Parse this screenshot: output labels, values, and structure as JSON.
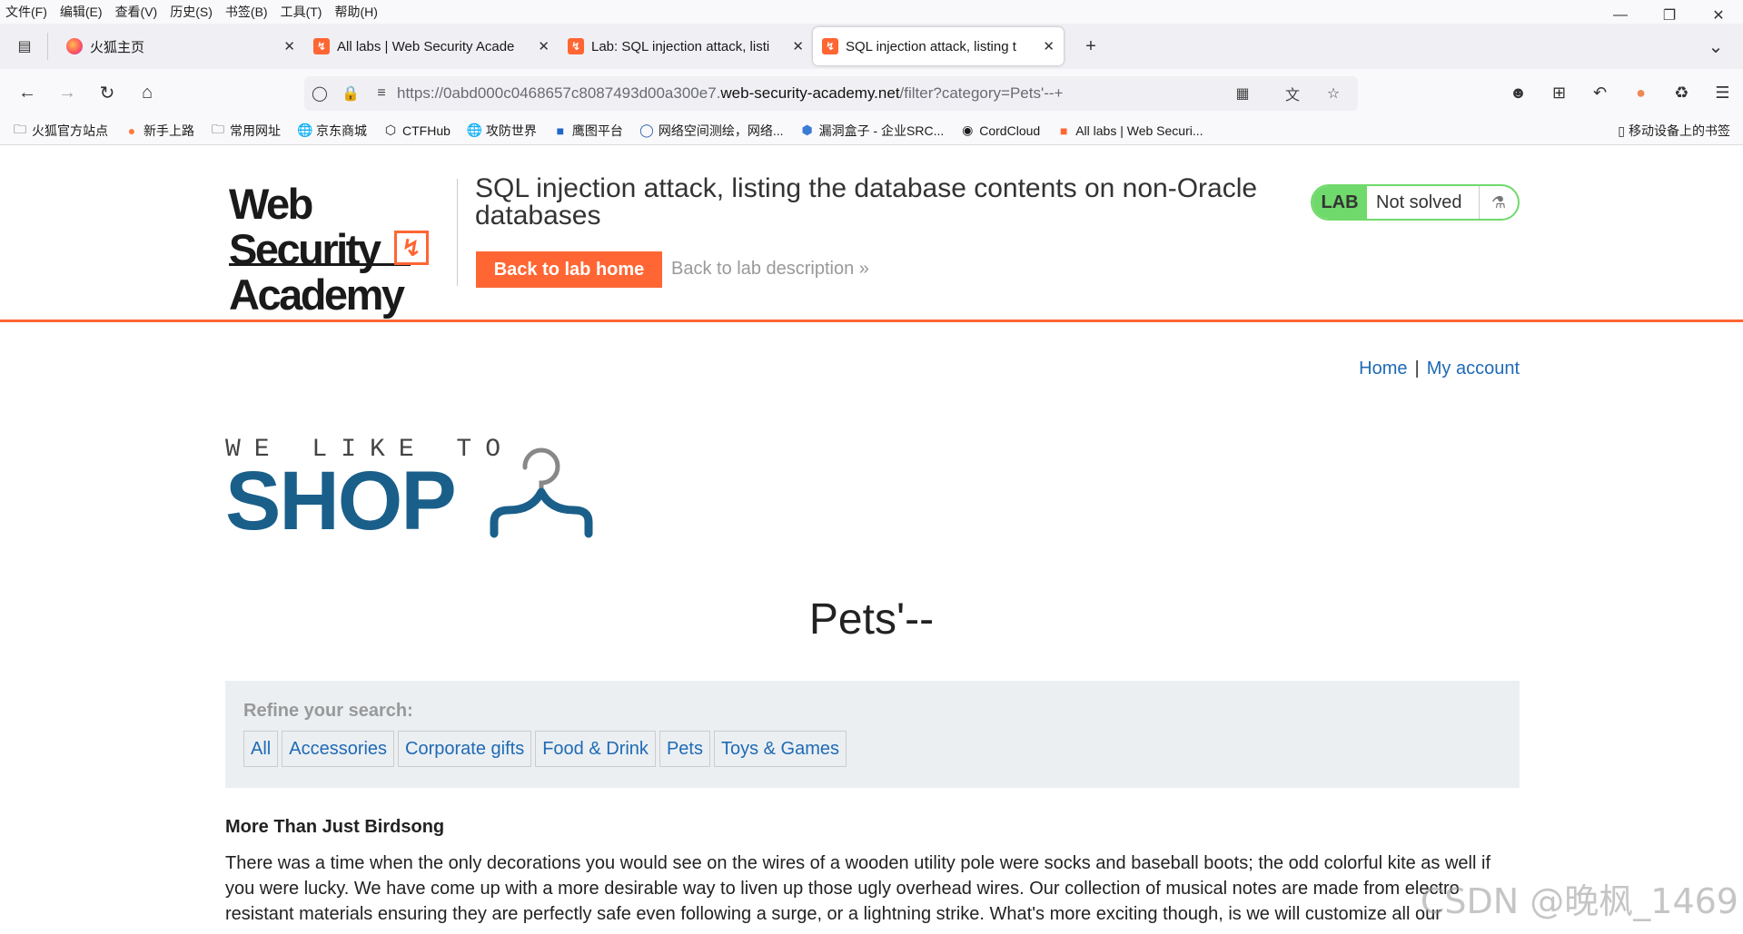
{
  "menubar": [
    "文件(F)",
    "编辑(E)",
    "查看(V)",
    "历史(S)",
    "书签(B)",
    "工具(T)",
    "帮助(H)"
  ],
  "tabs": [
    {
      "title": "火狐主页",
      "icon": "firefox-icon"
    },
    {
      "title": "All labs | Web Security Acade",
      "icon": "web-security-academy-icon"
    },
    {
      "title": "Lab: SQL injection attack, listi",
      "icon": "web-security-academy-icon"
    },
    {
      "title": "SQL injection attack, listing t",
      "icon": "web-security-academy-icon"
    }
  ],
  "url": {
    "prefix": "https://0abd000c0468657c8087493d00a300e7.",
    "domain": "web-security-academy.net",
    "suffix": "/filter?category=Pets'--+"
  },
  "bookmarks": [
    "火狐官方站点",
    "新手上路",
    "常用网址",
    "京东商城",
    "CTFHub",
    "攻防世界",
    "鹰图平台",
    "网络空间测绘，网络...",
    "漏洞盒子 - 企业SRC...",
    "CordCloud",
    "All labs | Web Securi..."
  ],
  "bookmarks_right": "移动设备上的书签",
  "academy": {
    "logo_line1": "Web Security",
    "logo_line2": "Academy",
    "lab_title": "SQL injection attack, listing the database contents on non-Oracle databases",
    "back_home": "Back to lab home",
    "back_desc": "Back to lab description",
    "badge_lab": "LAB",
    "badge_status": "Not solved"
  },
  "nav": {
    "home": "Home",
    "sep": "|",
    "account": "My account"
  },
  "shop": {
    "tagline": "WE LIKE TO",
    "word": "SHOP"
  },
  "category_title": "Pets'--",
  "refine": {
    "label": "Refine your search:",
    "categories": [
      "All",
      "Accessories",
      "Corporate gifts",
      "Food & Drink",
      "Pets",
      "Toys & Games"
    ]
  },
  "product": {
    "name": "More Than Just Birdsong",
    "description": "There was a time when the only decorations you would see on the wires of a wooden utility pole were socks and baseball boots; the odd colorful kite as well if you were lucky. We have come up with a more desirable way to liven up those ugly overhead wires. Our collection of musical notes are made from electro resistant materials ensuring they are perfectly safe even following a surge, or a lightning strike. What's more exciting though, is we will customize all our"
  },
  "watermark": "CSDN @晚枫_1469",
  "colors": {
    "accent": "#ff6633",
    "link": "#1f6ab5",
    "lab_green": "#70d96b",
    "shop_blue": "#1a5f8a"
  }
}
